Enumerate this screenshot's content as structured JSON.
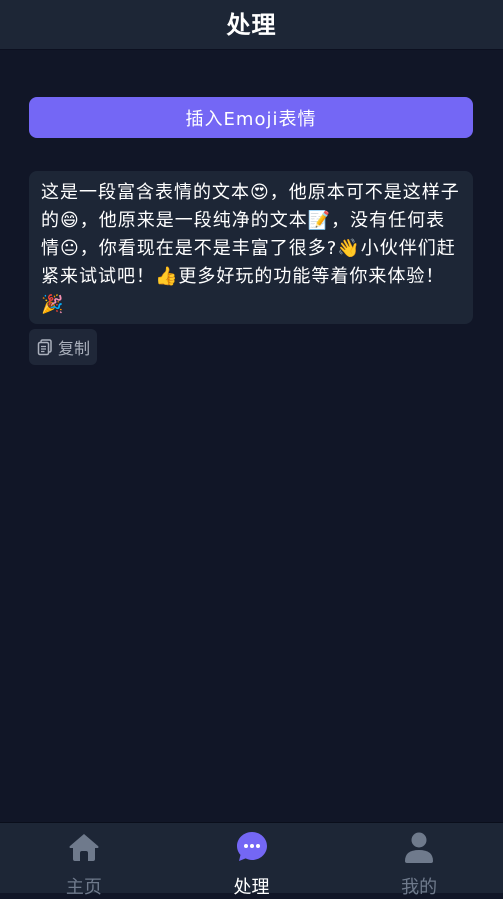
{
  "header": {
    "title": "处理"
  },
  "insert_button": {
    "label": "插入Emoji表情"
  },
  "text_card": {
    "content": "这是一段富含表情的文本😍，他原本可不是这样子的😄，他原来是一段纯净的文本📝，没有任何表情😐，你看现在是不是丰富了很多?👋小伙伴们赶紧来试试吧！👍更多好玩的功能等着你来体验！🎉"
  },
  "copy_button": {
    "label": "复制",
    "icon": "copy-icon"
  },
  "tabbar": {
    "items": [
      {
        "label": "主页",
        "icon": "home-icon",
        "active": false
      },
      {
        "label": "处理",
        "icon": "chat-bubble-icon",
        "active": true
      },
      {
        "label": "我的",
        "icon": "user-icon",
        "active": false
      }
    ]
  },
  "colors": {
    "background": "#111627",
    "surface": "#1d2636",
    "accent": "#7467f5",
    "inactive": "#6f7a8c"
  }
}
